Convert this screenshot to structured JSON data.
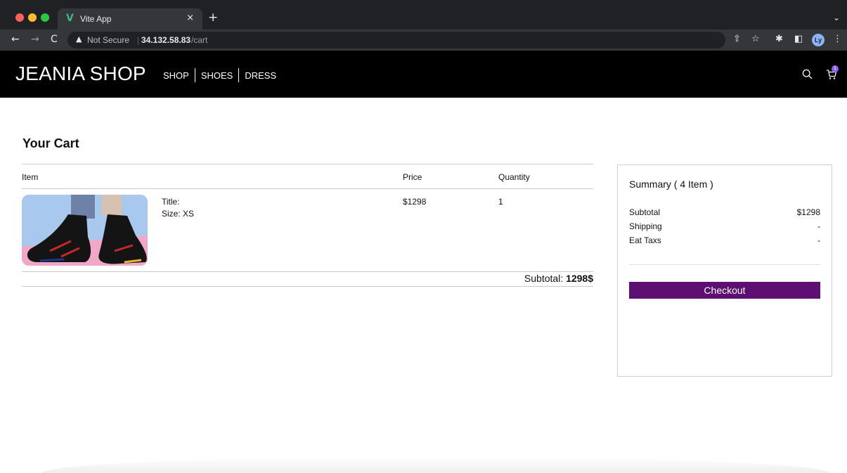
{
  "browser": {
    "tab_title": "Vite App",
    "tab_favicon": "V",
    "tab_close": "×",
    "new_tab": "+",
    "tab_menu": "⌄",
    "security_label": "Not Secure",
    "separator": "|",
    "url_host": "34.132.58.83",
    "url_path": "/cart",
    "profile_initials": "Ly",
    "icons": {
      "back": "←",
      "forward": "→",
      "reload": "C",
      "warning": "▲",
      "share": "⇧",
      "star": "☆",
      "extensions": "✱",
      "sidepanel": "◧",
      "more": "⋮"
    }
  },
  "header": {
    "logo": "JEANIA SHOP",
    "nav": [
      {
        "label": "SHOP"
      },
      {
        "label": "SHOES"
      },
      {
        "label": "DRESS"
      }
    ],
    "cart_count": "1"
  },
  "cart": {
    "title": "Your Cart",
    "columns": {
      "item": "Item",
      "price": "Price",
      "quantity": "Quantity"
    },
    "items": [
      {
        "title_label": "Title:",
        "size_label": "Size: XS",
        "price": "$1298",
        "quantity": "1"
      }
    ],
    "subtotal_label": "Subtotal:",
    "subtotal_value": "1298$"
  },
  "summary": {
    "title": "Summary ( 4 Item )",
    "rows": [
      {
        "label": "Subtotal",
        "value": "$1298"
      },
      {
        "label": "Shipping",
        "value": "-"
      },
      {
        "label": "Eat Taxs",
        "value": "-"
      }
    ],
    "checkout_label": "Checkout"
  },
  "colors": {
    "header_bg": "#000000",
    "checkout_bg": "#5e0f72",
    "cart_badge": "#8b5cf6"
  }
}
